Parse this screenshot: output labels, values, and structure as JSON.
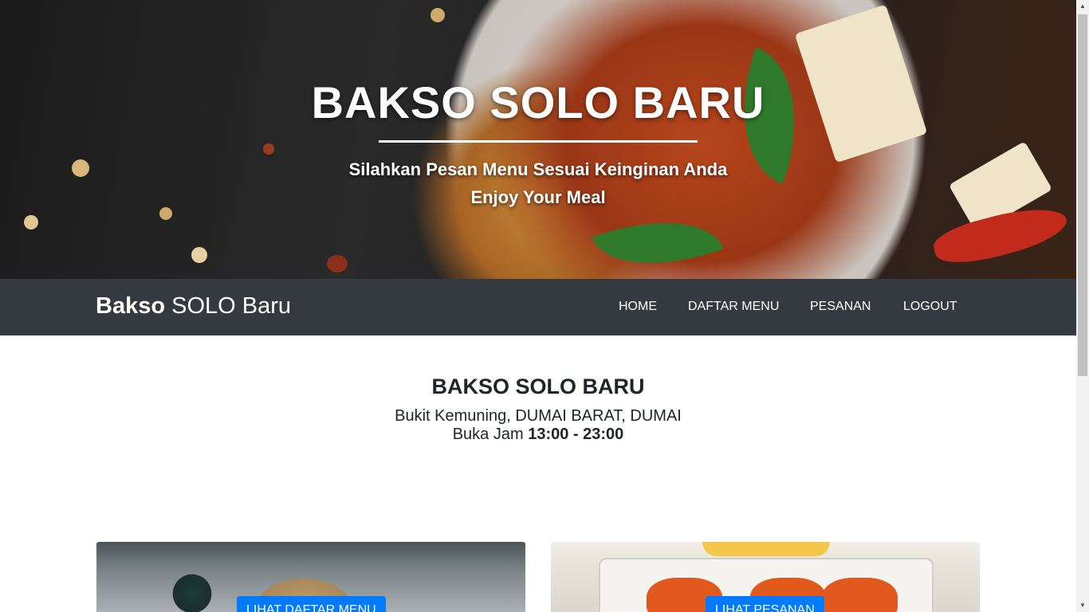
{
  "hero": {
    "title": "BAKSO SOLO BARU",
    "subtitle_line1": "Silahkan Pesan Menu Sesuai Keinginan Anda",
    "subtitle_line2": "Enjoy Your Meal"
  },
  "navbar": {
    "brand_bold": "Bakso",
    "brand_rest": " SOLO Baru",
    "items": [
      {
        "label": "HOME"
      },
      {
        "label": "DAFTAR MENU"
      },
      {
        "label": "PESANAN"
      },
      {
        "label": "LOGOUT"
      }
    ]
  },
  "info": {
    "title": "BAKSO SOLO BARU",
    "address": "Bukit Kemuning, DUMAI BARAT, DUMAI",
    "hours_prefix": "Buka Jam ",
    "hours_value": "13:00 - 23:00"
  },
  "cards": {
    "menu_button": "LIHAT DAFTAR MENU",
    "order_button": "LIHAT PESANAN"
  },
  "colors": {
    "navbar": "#343a40",
    "primary": "#007bff"
  },
  "icons": {
    "scroll_up": "triangle-up-icon",
    "scroll_down": "triangle-down-icon"
  }
}
